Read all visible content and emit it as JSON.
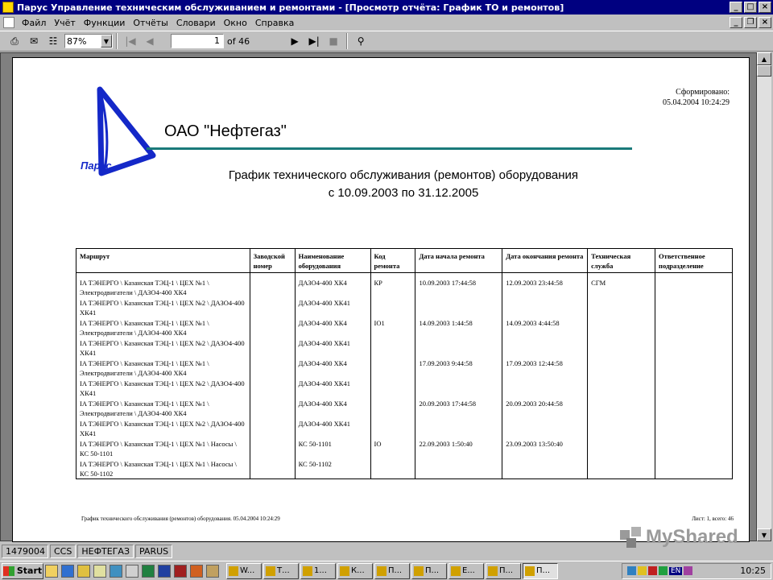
{
  "window": {
    "title": "Парус Управление техническим обслуживанием и ремонтами - [Просмотр отчёта: График ТО и ремонтов]"
  },
  "menu": [
    "Файл",
    "Учёт",
    "Функции",
    "Отчёты",
    "Словари",
    "Окно",
    "Справка"
  ],
  "toolbar": {
    "zoom": "87%",
    "page_current": "1",
    "page_of": "of 46"
  },
  "report": {
    "org": "ОАО \"Нефтегаз\"",
    "logo_text": "Парус",
    "stamp_label": "Сформировано:",
    "stamp_date": "05.04.2004 10:24:29",
    "title_line1": "График технического обслуживания (ремонтов) оборудования",
    "title_line2": "с 10.09.2003  по 31.12.2005",
    "columns": [
      "Маршрут",
      "Заводской номер",
      "Наименование оборудования",
      "Код ремонта",
      "Дата начала ремонта",
      "Дата окончания ремонта",
      "Техническая служба",
      "Ответственное подразделение"
    ],
    "rows": [
      {
        "route": "IA ТЭНЕРГО \\ Казанская  ТЭЦ-1 \\ ЦЕХ №1 \\ Электродвигатели \\ ДАЗО4-400 ХК4",
        "serial": "",
        "equip": "ДАЗО4-400 ХК4",
        "code": "КР",
        "start": "10.09.2003  17:44:58",
        "end": "12.09.2003  23:44:58",
        "service": "СГМ",
        "dept": ""
      },
      {
        "route": "IA ТЭНЕРГО \\ Казанская  ТЭЦ-1 \\ ЦЕХ №2 \\ ДАЗО4-400 ХК41",
        "serial": "",
        "equip": "ДАЗО4-400 ХК41",
        "code": "",
        "start": "",
        "end": "",
        "service": "",
        "dept": ""
      },
      {
        "route": "IA ТЭНЕРГО \\ Казанская  ТЭЦ-1 \\ ЦЕХ №1 \\ Электродвигатели \\ ДАЗО4-400 ХК4",
        "serial": "",
        "equip": "ДАЗО4-400 ХК4",
        "code": "IO1",
        "start": "14.09.2003   1:44:58",
        "end": "14.09.2003   4:44:58",
        "service": "",
        "dept": ""
      },
      {
        "route": "IA ТЭНЕРГО \\ Казанская  ТЭЦ-1 \\ ЦЕХ №2 \\ ДАЗО4-400 ХК41",
        "serial": "",
        "equip": "ДАЗО4-400 ХК41",
        "code": "",
        "start": "",
        "end": "",
        "service": "",
        "dept": ""
      },
      {
        "route": "IA ТЭНЕРГО \\ Казанская  ТЭЦ-1 \\ ЦЕХ №1 \\ Электродвигатели \\ ДАЗО4-400 ХК4",
        "serial": "",
        "equip": "ДАЗО4-400 ХК4",
        "code": "",
        "start": "17.09.2003   9:44:58",
        "end": "17.09.2003  12:44:58",
        "service": "",
        "dept": ""
      },
      {
        "route": "IA ТЭНЕРГО \\ Казанская  ТЭЦ-1 \\ ЦЕХ №2 \\ ДАЗО4-400 ХК41",
        "serial": "",
        "equip": "ДАЗО4-400 ХК41",
        "code": "",
        "start": "",
        "end": "",
        "service": "",
        "dept": ""
      },
      {
        "route": "IA ТЭНЕРГО \\ Казанская  ТЭЦ-1 \\ ЦЕХ №1 \\ Электродвигатели \\ ДАЗО4-400 ХК4",
        "serial": "",
        "equip": "ДАЗО4-400 ХК4",
        "code": "",
        "start": "20.09.2003  17:44:58",
        "end": "20.09.2003  20:44:58",
        "service": "",
        "dept": ""
      },
      {
        "route": "IA ТЭНЕРГО \\ Казанская  ТЭЦ-1 \\ ЦЕХ №2 \\ ДАЗО4-400 ХК41",
        "serial": "",
        "equip": "ДАЗО4-400 ХК41",
        "code": "",
        "start": "",
        "end": "",
        "service": "",
        "dept": ""
      },
      {
        "route": "IA ТЭНЕРГО \\ Казанская  ТЭЦ-1 \\ ЦЕХ №1 \\ Насосы \\ КС 50-1101",
        "serial": "",
        "equip": "КС 50-1101",
        "code": "IO",
        "start": "22.09.2003   1:50:40",
        "end": "23.09.2003  13:50:40",
        "service": "",
        "dept": ""
      },
      {
        "route": "IA ТЭНЕРГО \\ Казанская  ТЭЦ-1 \\ ЦЕХ №1 \\ Насосы \\ КС 50-1102",
        "serial": "",
        "equip": "КС 50-1102",
        "code": "",
        "start": "",
        "end": "",
        "service": "",
        "dept": ""
      }
    ],
    "footer_left": "График технического обслуживания (ремонтов) оборудования. 05.04.2004 10:24:29",
    "footer_right": "Лист: 1, всего: 46"
  },
  "status": [
    "1479004",
    "CCS",
    "НЕФТЕГАЗ",
    "PARUS"
  ],
  "taskbar": {
    "start": "Start",
    "tasks": [
      "W...",
      "Т...",
      "1...",
      "К...",
      "П...",
      "П...",
      "E...",
      "П...",
      "П..."
    ],
    "clock": "10:25",
    "lang": "EN"
  },
  "watermark": "MyShared",
  "colors": {
    "titlebar": "#000080",
    "accent_line": "#1a7a7a",
    "logo_blue": "#1428c8"
  }
}
